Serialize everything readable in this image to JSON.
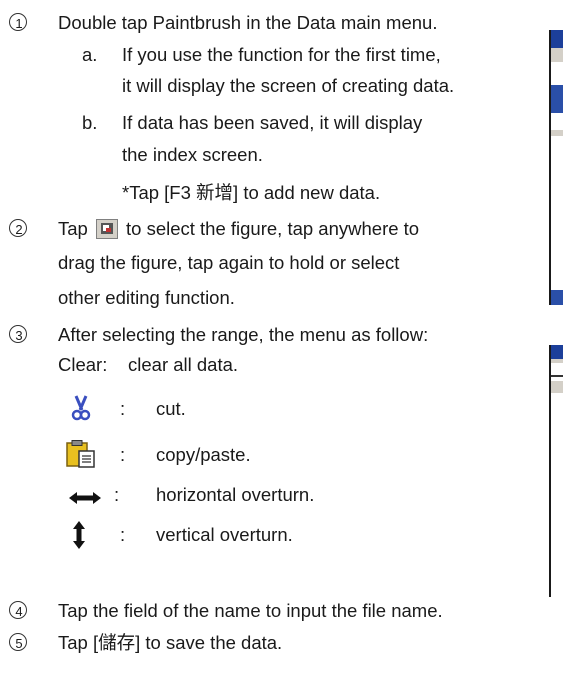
{
  "steps": {
    "s1": {
      "num": "1",
      "text": "Double tap Paintbrush in the Data main menu."
    },
    "s1a": {
      "marker": "a.",
      "line1": "If you use the function for the first time,",
      "line2": "it will display the screen of creating data."
    },
    "s1b": {
      "marker": "b.",
      "line1": "If data has been saved, it will display",
      "line2": "the index screen.",
      "line3": "*Tap [F3 新增] to add new data."
    },
    "s2": {
      "num": "2",
      "text_before": "Tap",
      "text_after": "to select the figure, tap anywhere to",
      "line2": "drag the figure, tap again to hold or select",
      "line3": "other  editing function."
    },
    "s3": {
      "num": "3",
      "text": "After selecting the range, the menu as follow:",
      "clear_label": "Clear:",
      "clear_desc": "clear all data."
    },
    "menu_items": [
      {
        "icon": "scissors-icon",
        "sep": ":",
        "desc": "cut."
      },
      {
        "icon": "clipboard-icon",
        "sep": ":",
        "desc": "copy/paste."
      },
      {
        "icon": "horizontal-arrow-icon",
        "sep": ":",
        "desc": "horizontal overturn."
      },
      {
        "icon": "vertical-arrow-icon",
        "sep": ":",
        "desc": "vertical overturn."
      }
    ],
    "s4": {
      "num": "4",
      "text": "Tap the field of the name to input the file name."
    },
    "s5": {
      "num": "5",
      "text": "Tap [儲存] to save the data."
    }
  },
  "colors": {
    "scissors": "#3a4fbf",
    "clipboard": "#e8c020",
    "arrow": "#111111",
    "frame_blue": "#1c3f9a"
  }
}
